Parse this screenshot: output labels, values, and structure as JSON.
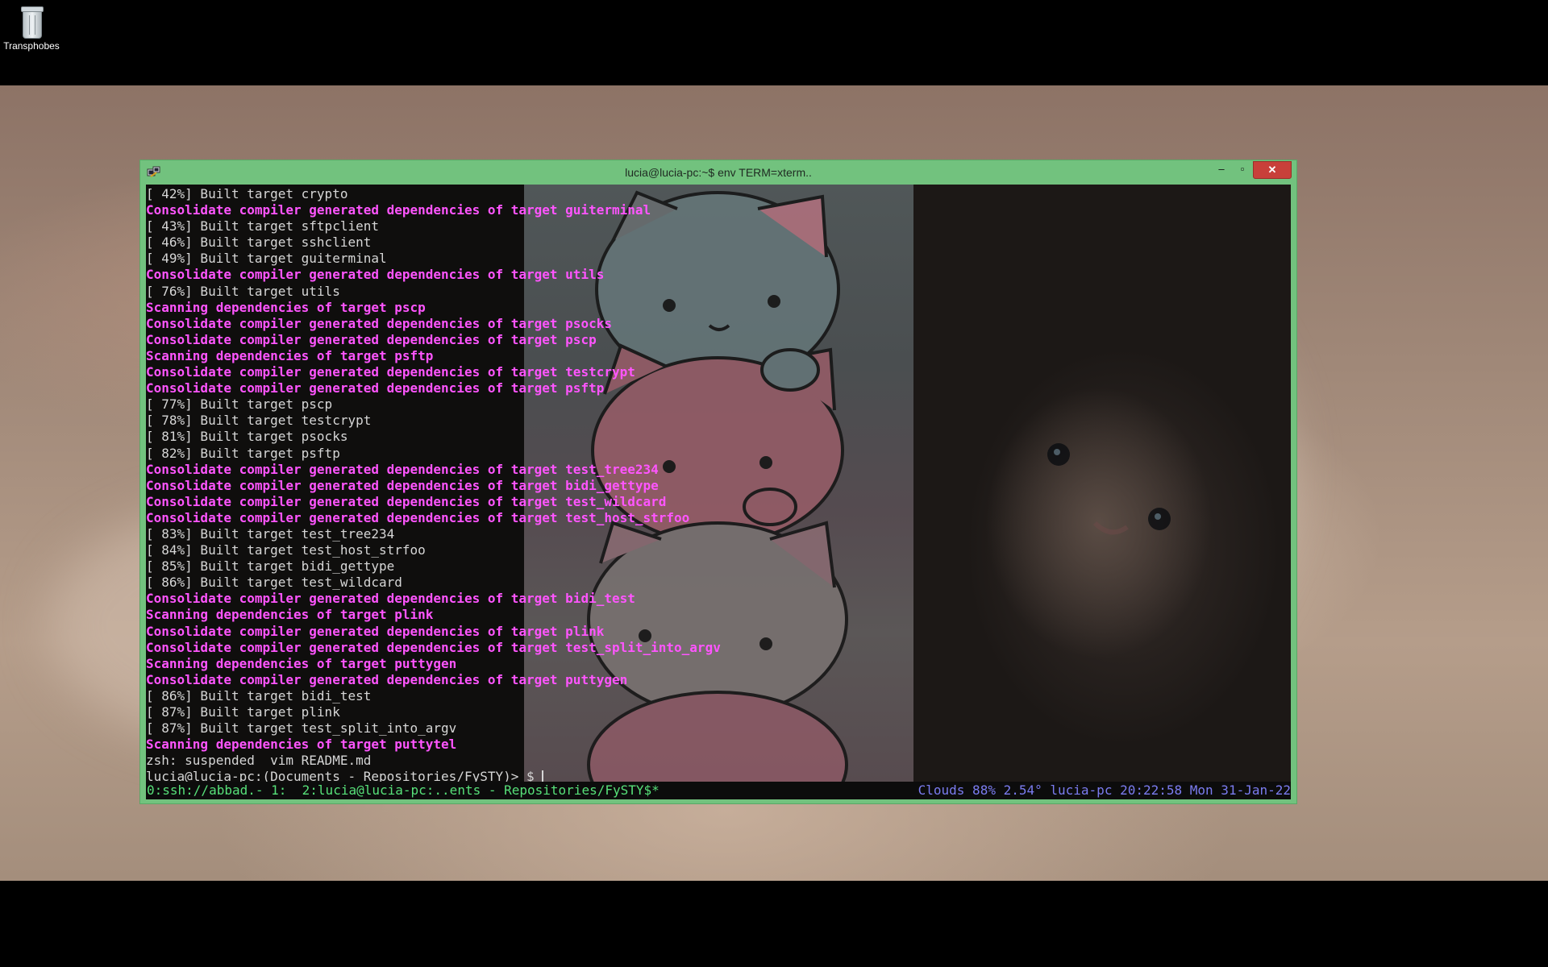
{
  "desktop": {
    "icon_label": "Transphobes",
    "icon": "recycle-bin-icon"
  },
  "window": {
    "title": "lucia@lucia-pc:~$ env TERM=xterm..",
    "app_icon": "putty-icon",
    "minimize_glyph": "–",
    "maximize_glyph": "▫",
    "close_glyph": "✕",
    "accent_color": "#72c27e"
  },
  "terminal": {
    "lines": [
      {
        "text": "[ 42%] Built target crypto",
        "style": "plain"
      },
      {
        "text": "Consolidate compiler generated dependencies of target guiterminal",
        "style": "magenta"
      },
      {
        "text": "[ 43%] Built target sftpclient",
        "style": "plain"
      },
      {
        "text": "[ 46%] Built target sshclient",
        "style": "plain"
      },
      {
        "text": "[ 49%] Built target guiterminal",
        "style": "plain"
      },
      {
        "text": "Consolidate compiler generated dependencies of target utils",
        "style": "magenta"
      },
      {
        "text": "[ 76%] Built target utils",
        "style": "plain"
      },
      {
        "text": "Scanning dependencies of target pscp",
        "style": "magenta"
      },
      {
        "text": "Consolidate compiler generated dependencies of target psocks",
        "style": "magenta"
      },
      {
        "text": "Consolidate compiler generated dependencies of target pscp",
        "style": "magenta"
      },
      {
        "text": "Scanning dependencies of target psftp",
        "style": "magenta"
      },
      {
        "text": "Consolidate compiler generated dependencies of target testcrypt",
        "style": "magenta"
      },
      {
        "text": "Consolidate compiler generated dependencies of target psftp",
        "style": "magenta"
      },
      {
        "text": "[ 77%] Built target pscp",
        "style": "plain"
      },
      {
        "text": "[ 78%] Built target testcrypt",
        "style": "plain"
      },
      {
        "text": "[ 81%] Built target psocks",
        "style": "plain"
      },
      {
        "text": "[ 82%] Built target psftp",
        "style": "plain"
      },
      {
        "text": "Consolidate compiler generated dependencies of target test_tree234",
        "style": "magenta"
      },
      {
        "text": "Consolidate compiler generated dependencies of target bidi_gettype",
        "style": "magenta"
      },
      {
        "text": "Consolidate compiler generated dependencies of target test_wildcard",
        "style": "magenta"
      },
      {
        "text": "Consolidate compiler generated dependencies of target test_host_strfoo",
        "style": "magenta"
      },
      {
        "text": "[ 83%] Built target test_tree234",
        "style": "plain"
      },
      {
        "text": "[ 84%] Built target test_host_strfoo",
        "style": "plain"
      },
      {
        "text": "[ 85%] Built target bidi_gettype",
        "style": "plain"
      },
      {
        "text": "[ 86%] Built target test_wildcard",
        "style": "plain"
      },
      {
        "text": "Consolidate compiler generated dependencies of target bidi_test",
        "style": "magenta"
      },
      {
        "text": "Scanning dependencies of target plink",
        "style": "magenta"
      },
      {
        "text": "Consolidate compiler generated dependencies of target plink",
        "style": "magenta"
      },
      {
        "text": "Consolidate compiler generated dependencies of target test_split_into_argv",
        "style": "magenta"
      },
      {
        "text": "Scanning dependencies of target puttygen",
        "style": "magenta"
      },
      {
        "text": "Consolidate compiler generated dependencies of target puttygen",
        "style": "magenta"
      },
      {
        "text": "[ 86%] Built target bidi_test",
        "style": "plain"
      },
      {
        "text": "[ 87%] Built target plink",
        "style": "plain"
      },
      {
        "text": "[ 87%] Built target test_split_into_argv",
        "style": "plain"
      },
      {
        "text": "Scanning dependencies of target puttytel",
        "style": "magenta"
      },
      {
        "text": "zsh: suspended  vim README.md",
        "style": "plain"
      }
    ],
    "prompt": "lucia@lucia-pc:(Documents - Repositories/FySTY)> $ ",
    "colors": {
      "plain": "#d6d6d6",
      "magenta": "#ff55ff",
      "status_green": "#57e079",
      "status_blue": "#7b7cf0"
    }
  },
  "statusbar": {
    "left": "0:ssh://abbad.- 1:  2:lucia@lucia-pc:..ents - Repositories/FySTY$*",
    "right": "Clouds 88% 2.54° lucia-pc 20:22:58 Mon 31-Jan-22"
  }
}
